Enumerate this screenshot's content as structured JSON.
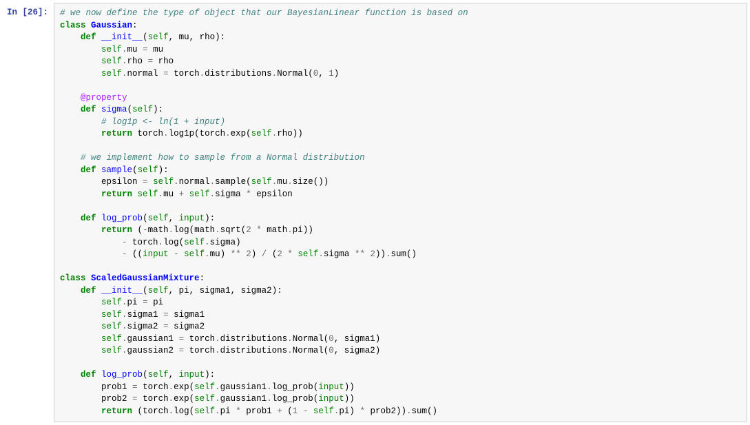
{
  "prompt": "In [26]:",
  "code": {
    "l1_comment": "# we now define the type of object that our BayesianLinear function is based on",
    "l2_class_kw": "class",
    "l2_class_name": "Gaussian",
    "l3_def": "def",
    "l3_fn": "__init__",
    "l3_self": "self",
    "l3_p1": "mu",
    "l3_p2": "rho",
    "l4_self": "self",
    "l4_attr": "mu",
    "l4_rhs": "mu",
    "l5_self": "self",
    "l5_attr": "rho",
    "l5_rhs": "rho",
    "l6_self": "self",
    "l6_attr": "normal",
    "l6_torch": "torch",
    "l6_dist": "distributions",
    "l6_normal": "Normal",
    "l6_n0": "0",
    "l6_n1": "1",
    "l8_dec": "@property",
    "l9_def": "def",
    "l9_fn": "sigma",
    "l9_self": "self",
    "l10_c": "# log1p <- ln(1 + input)",
    "l11_ret": "return",
    "l11_torch1": "torch",
    "l11_log1p": "log1p",
    "l11_torch2": "torch",
    "l11_exp": "exp",
    "l11_self": "self",
    "l11_rho": "rho",
    "l13_c": "# we implement how to sample from a Normal distribution",
    "l14_def": "def",
    "l14_fn": "sample",
    "l14_self": "self",
    "l15_eps": "epsilon",
    "l15_self1": "self",
    "l15_norm": "normal",
    "l15_samp": "sample",
    "l15_self2": "self",
    "l15_mu": "mu",
    "l15_size": "size",
    "l16_ret": "return",
    "l16_self1": "self",
    "l16_mu": "mu",
    "l16_self2": "self",
    "l16_sig": "sigma",
    "l16_eps": "epsilon",
    "l18_def": "def",
    "l18_fn": "log_prob",
    "l18_self": "self",
    "l18_in": "input",
    "l19_ret": "return",
    "l19_math1": "math",
    "l19_log": "log",
    "l19_math2": "math",
    "l19_sqrt": "sqrt",
    "l19_n2": "2",
    "l19_math3": "math",
    "l19_pi": "pi",
    "l20_torch": "torch",
    "l20_log": "log",
    "l20_self": "self",
    "l20_sig": "sigma",
    "l21_in": "input",
    "l21_self1": "self",
    "l21_mu": "mu",
    "l21_n2a": "2",
    "l21_n2b": "2",
    "l21_self2": "self",
    "l21_sig": "sigma",
    "l21_n2c": "2",
    "l21_sum": "sum",
    "l23_ckw": "class",
    "l23_cn": "ScaledGaussianMixture",
    "l24_def": "def",
    "l24_fn": "__init__",
    "l24_self": "self",
    "l24_p1": "pi",
    "l24_p2": "sigma1",
    "l24_p3": "sigma2",
    "l25_self": "self",
    "l25_attr": "pi",
    "l25_rhs": "pi",
    "l26_self": "self",
    "l26_attr": "sigma1",
    "l26_rhs": "sigma1",
    "l27_self": "self",
    "l27_attr": "sigma2",
    "l27_rhs": "sigma2",
    "l28_self": "self",
    "l28_attr": "gaussian1",
    "l28_torch": "torch",
    "l28_dist": "distributions",
    "l28_norm": "Normal",
    "l28_n0": "0",
    "l28_sig": "sigma1",
    "l29_self": "self",
    "l29_attr": "gaussian2",
    "l29_torch": "torch",
    "l29_dist": "distributions",
    "l29_norm": "Normal",
    "l29_n0": "0",
    "l29_sig": "sigma2",
    "l31_def": "def",
    "l31_fn": "log_prob",
    "l31_self": "self",
    "l31_in": "input",
    "l32_p1": "prob1",
    "l32_torch": "torch",
    "l32_exp": "exp",
    "l32_self": "self",
    "l32_g": "gaussian1",
    "l32_lp": "log_prob",
    "l32_in": "input",
    "l33_p2": "prob2",
    "l33_torch": "torch",
    "l33_exp": "exp",
    "l33_self": "self",
    "l33_g": "gaussian1",
    "l33_lp": "log_prob",
    "l33_in": "input",
    "l34_ret": "return",
    "l34_torch": "torch",
    "l34_log": "log",
    "l34_self1": "self",
    "l34_pi1": "pi",
    "l34_p1": "prob1",
    "l34_n1": "1",
    "l34_self2": "self",
    "l34_pi2": "pi",
    "l34_p2": "prob2",
    "l34_sum": "sum"
  }
}
